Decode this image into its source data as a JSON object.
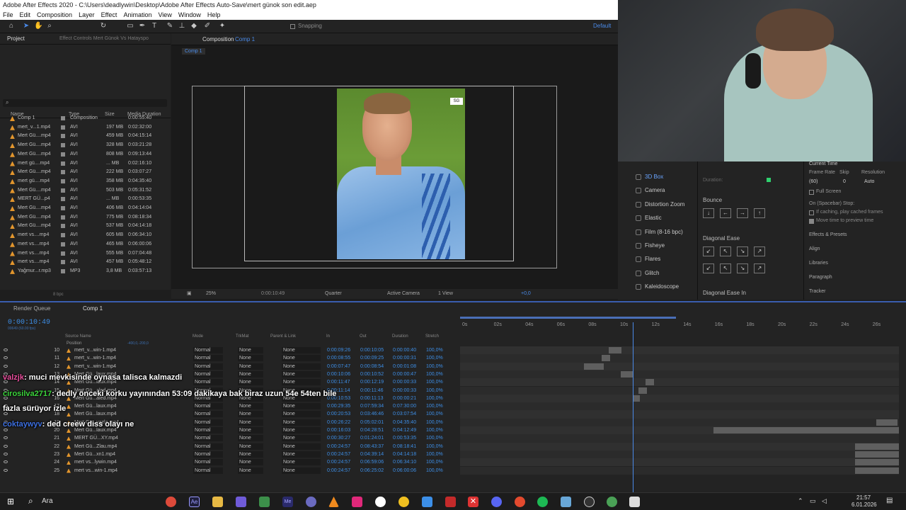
{
  "window": {
    "title": "Adobe After Effects 2020 - C:\\Users\\deadlywin\\Desktop\\Adobe After Effects Auto-Save\\mert günok son edit.aep"
  },
  "menu": [
    "File",
    "Edit",
    "Composition",
    "Layer",
    "Effect",
    "Animation",
    "View",
    "Window",
    "Help"
  ],
  "toolbar": {
    "snapping": "Snapping",
    "workspace": "Default"
  },
  "project": {
    "tab": "Project",
    "effect_controls": "Effect Controls Mert Günok Vs Hatayspo",
    "columns": {
      "name": "Name",
      "type": "Type",
      "size": "Size",
      "duration": "Media Duration"
    },
    "items": [
      {
        "name": "Comp 1",
        "type": "Composition",
        "size": "",
        "duration": "0:00:55:40"
      },
      {
        "name": "mert_v...1.mp4",
        "type": "AVI",
        "size": "197 MB",
        "duration": "0:02:32:00"
      },
      {
        "name": "Mert Gü....mp4",
        "type": "AVI",
        "size": "459 MB",
        "duration": "0:04:15:14"
      },
      {
        "name": "Mert Gü....mp4",
        "type": "AVI",
        "size": "328 MB",
        "duration": "0:03:21:28"
      },
      {
        "name": "Mert Gü....mp4",
        "type": "AVI",
        "size": "808 MB",
        "duration": "0:09:13:44"
      },
      {
        "name": "mert gü....mp4",
        "type": "AVI",
        "size": "... MB",
        "duration": "0:02:16:10"
      },
      {
        "name": "Mert Gü....mp4",
        "type": "AVI",
        "size": "222 MB",
        "duration": "0:03:07:27"
      },
      {
        "name": "mert gü....mp4",
        "type": "AVI",
        "size": "358 MB",
        "duration": "0:04:35:40"
      },
      {
        "name": "Mert Gü....mp4",
        "type": "AVI",
        "size": "503 MB",
        "duration": "0:05:31:52"
      },
      {
        "name": "MERT GÜ...p4",
        "type": "AVI",
        "size": "... MB",
        "duration": "0:00:53:35"
      },
      {
        "name": "Mert Gü....mp4",
        "type": "AVI",
        "size": "406 MB",
        "duration": "0:04:14:04"
      },
      {
        "name": "Mert Gü....mp4",
        "type": "AVI",
        "size": "775 MB",
        "duration": "0:08:18:34"
      },
      {
        "name": "Mert Gü....mp4",
        "type": "AVI",
        "size": "537 MB",
        "duration": "0:04:14:18"
      },
      {
        "name": "mert vs....mp4",
        "type": "AVI",
        "size": "605 MB",
        "duration": "0:06:34:10"
      },
      {
        "name": "mert vs....mp4",
        "type": "AVI",
        "size": "465 MB",
        "duration": "0:06:00:06"
      },
      {
        "name": "mert vs....mp4",
        "type": "AVI",
        "size": "555 MB",
        "duration": "0:07:04:48"
      },
      {
        "name": "mert vs....mp4",
        "type": "AVI",
        "size": "457 MB",
        "duration": "0:05:48:12"
      },
      {
        "name": "Yağmur...r.mp3",
        "type": "MP3",
        "size": "3,8 MB",
        "duration": "0:03:57:13"
      }
    ],
    "bpc": "8 bpc"
  },
  "composition": {
    "tab": "Composition",
    "name": "Comp 1",
    "crumb": "Comp 1",
    "zoom": "25%",
    "time": "0:00:10:49",
    "quality": "Quarter",
    "camera": "Active Camera",
    "views": "1 View",
    "exposure": "+0,0",
    "badge": "SG"
  },
  "effects_panel": {
    "presets": [
      "3D Box",
      "Camera",
      "Distortion Zoom",
      "Elastic",
      "Film (8-16 bpc)",
      "Fisheye",
      "Flares",
      "Glitch",
      "Kaleidoscope"
    ],
    "duration_label": "Duration:",
    "bounce": "Bounce",
    "diagonal_ease": "Diagonal Ease",
    "diagonal_ease_in": "Diagonal Ease In"
  },
  "preview": {
    "current_time": "Current Time",
    "frame_rate_label": "Frame Rate",
    "skip_label": "Skip",
    "resolution_label": "Resolution",
    "frame_rate": "(60)",
    "skip": "0",
    "resolution": "Auto",
    "full_screen": "Full Screen",
    "on_stop": "On (Spacebar) Stop:",
    "if_caching": "If caching, play cached frames",
    "move_time": "Move time to preview time",
    "panels": [
      "Effects & Presets",
      "Align",
      "Libraries",
      "Paragraph",
      "Tracker"
    ]
  },
  "timeline": {
    "render_queue": "Render Queue",
    "comp_tab": "Comp 1",
    "timecode": "0:00:10:49",
    "fps_sub": "00649 (60.00 fps)",
    "ruler": [
      "0s",
      "02s",
      "04s",
      "06s",
      "08s",
      "10s",
      "12s",
      "14s",
      "16s",
      "18s",
      "20s",
      "22s",
      "24s",
      "26s"
    ],
    "columns": {
      "source": "Source Name",
      "mode": "Mode",
      "trkmat": "TrkMat",
      "parent": "Parent & Link",
      "in": "In",
      "out": "Out",
      "duration": "Duration",
      "stretch": "Stretch"
    },
    "position_label": "Position",
    "position_value": "-400,0,-200,0",
    "layers": [
      {
        "num": "10",
        "name": "mert_v...win-1.mp4",
        "mode": "Normal",
        "trk": "None",
        "parent": "None",
        "in": "0:00:09:26",
        "out": "0:00:10:05",
        "dur": "0:00:00:40",
        "str": "100,0%"
      },
      {
        "num": "11",
        "name": "mert_v...win-1.mp4",
        "mode": "Normal",
        "trk": "None",
        "parent": "None",
        "in": "0:00:08:55",
        "out": "0:00:09:25",
        "dur": "0:00:00:31",
        "str": "100,0%"
      },
      {
        "num": "12",
        "name": "mert_v...win-1.mp4",
        "mode": "Normal",
        "trk": "None",
        "parent": "None",
        "in": "0:00:07:47",
        "out": "0:00:08:54",
        "dur": "0:00:01:08",
        "str": "100,0%"
      },
      {
        "num": "13",
        "name": "Mert Gü...laux.mp4",
        "mode": "Normal",
        "trk": "None",
        "parent": "None",
        "in": "0:00:10:06",
        "out": "0:00:10:52",
        "dur": "0:00:00:47",
        "str": "100,0%"
      },
      {
        "num": "14",
        "name": "Mert Gü...laux.mp4",
        "mode": "Normal",
        "trk": "None",
        "parent": "None",
        "in": "0:00:11:47",
        "out": "0:00:12:19",
        "dur": "0:00:00:33",
        "str": "100,0%"
      },
      {
        "num": "15",
        "name": "Mert Gü...aled.mp4",
        "mode": "Normal",
        "trk": "None",
        "parent": "None",
        "in": "0:00:11:14",
        "out": "0:00:11:46",
        "dur": "0:00:00:33",
        "str": "100,0%"
      },
      {
        "num": "16",
        "name": "Mert Gü...aled.mp4",
        "mode": "Normal",
        "trk": "None",
        "parent": "None",
        "in": "0:00:10:53",
        "out": "0:00:11:13",
        "dur": "0:00:00:21",
        "str": "100,0%"
      },
      {
        "num": "17",
        "name": "Mert Gü...laux.mp4",
        "mode": "Normal",
        "trk": "None",
        "parent": "None",
        "in": "0:00:29:35",
        "out": "0:07:59:34",
        "dur": "0:07:30:00",
        "str": "100,0%"
      },
      {
        "num": "18",
        "name": "Mert Gü...laux.mp4",
        "mode": "Normal",
        "trk": "None",
        "parent": "None",
        "in": "0:00:20:53",
        "out": "0:03:46:46",
        "dur": "0:03:07:54",
        "str": "100,0%"
      },
      {
        "num": "19",
        "name": "Mert Gü...yazla.mp4",
        "mode": "Normal",
        "trk": "None",
        "parent": "None",
        "in": "0:00:26:22",
        "out": "0:05:02:01",
        "dur": "0:04:35:40",
        "str": "100,0%"
      },
      {
        "num": "20",
        "name": "Mert Gü...laux.mp4",
        "mode": "Normal",
        "trk": "None",
        "parent": "None",
        "in": "0:00:16:03",
        "out": "0:04:28:51",
        "dur": "0:04:12:49",
        "str": "100,0%"
      },
      {
        "num": "21",
        "name": "MERT GÜ...XY.mp4",
        "mode": "Normal",
        "trk": "None",
        "parent": "None",
        "in": "0:00:30:27",
        "out": "0:01:24:01",
        "dur": "0:00:53:35",
        "str": "100,0%"
      },
      {
        "num": "22",
        "name": "Mert Gü...Zlau.mp4",
        "mode": "Normal",
        "trk": "None",
        "parent": "None",
        "in": "0:00:24:57",
        "out": "0:08:43:37",
        "dur": "0:08:18:41",
        "str": "100,0%"
      },
      {
        "num": "23",
        "name": "Mert Gü...xn1.mp4",
        "mode": "Normal",
        "trk": "None",
        "parent": "None",
        "in": "0:00:24:57",
        "out": "0:04:39:14",
        "dur": "0:04:14:18",
        "str": "100,0%"
      },
      {
        "num": "24",
        "name": "mert vs...lywin.mp4",
        "mode": "Normal",
        "trk": "None",
        "parent": "None",
        "in": "0:00:24:57",
        "out": "0:06:59:06",
        "dur": "0:06:34:10",
        "str": "100,0%"
      },
      {
        "num": "25",
        "name": "mert vs...win-1.mp4",
        "mode": "Normal",
        "trk": "None",
        "parent": "None",
        "in": "0:00:24:57",
        "out": "0:06:25:02",
        "dur": "0:06:00:06",
        "str": "100,0%"
      }
    ]
  },
  "chat": [
    {
      "user": "valzjk",
      "msg": ": muci mevkisinde oynasa talisca kalmazdi",
      "color": "#e84d9c"
    },
    {
      "user": "cirosilva2717",
      "msg": ": dedly önceki korku yayınından 53:09 dakikaya bak biraz uzun 54e 54ten bile",
      "color": "#3bd43b"
    },
    {
      "user": "",
      "msg": "fazla sürüyor izle",
      "color": "#ffffff"
    },
    {
      "user": "coktaywyv",
      "msg": ": ded creew diss olayı ne",
      "color": "#3c6fe0"
    }
  ],
  "taskbar": {
    "search": "Ara",
    "time": "21:57",
    "date": "6.01.2026"
  }
}
